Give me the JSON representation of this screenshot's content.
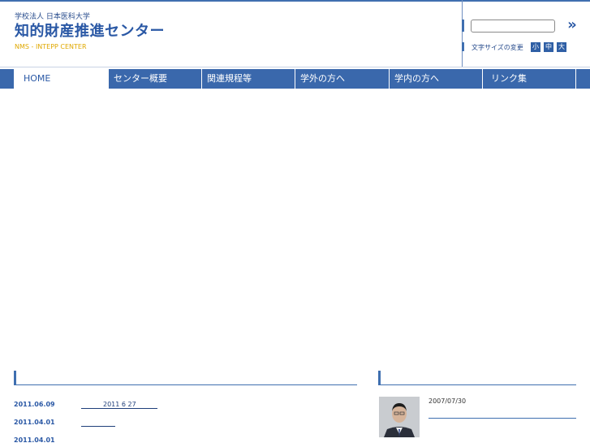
{
  "header": {
    "org": "学校法人 日本医科大学",
    "title": "知的財産推進センター",
    "subtitle": "NMS - INTEPP CENTER"
  },
  "search": {
    "value": "",
    "placeholder": "",
    "button_label": "»"
  },
  "font_size": {
    "label": "文字サイズの変更",
    "small": "小",
    "medium": "中",
    "large": "大"
  },
  "nav": {
    "items": [
      {
        "label": "HOME"
      },
      {
        "label": "センター概要"
      },
      {
        "label": "関連規程等"
      },
      {
        "label": "学外の方へ"
      },
      {
        "label": "学内の方へ"
      },
      {
        "label": "リンク集"
      }
    ]
  },
  "news": {
    "items": [
      {
        "date": "2011.06.09",
        "title": "2011 6 27"
      },
      {
        "date": "2011.04.01",
        "title": ""
      },
      {
        "date": "2011.04.01",
        "title": ""
      }
    ]
  },
  "message": {
    "date": "2007/07/30"
  },
  "colors": {
    "brand": "#2a58a5",
    "nav_bg": "#3a68ac",
    "accent": "#e0a800"
  }
}
